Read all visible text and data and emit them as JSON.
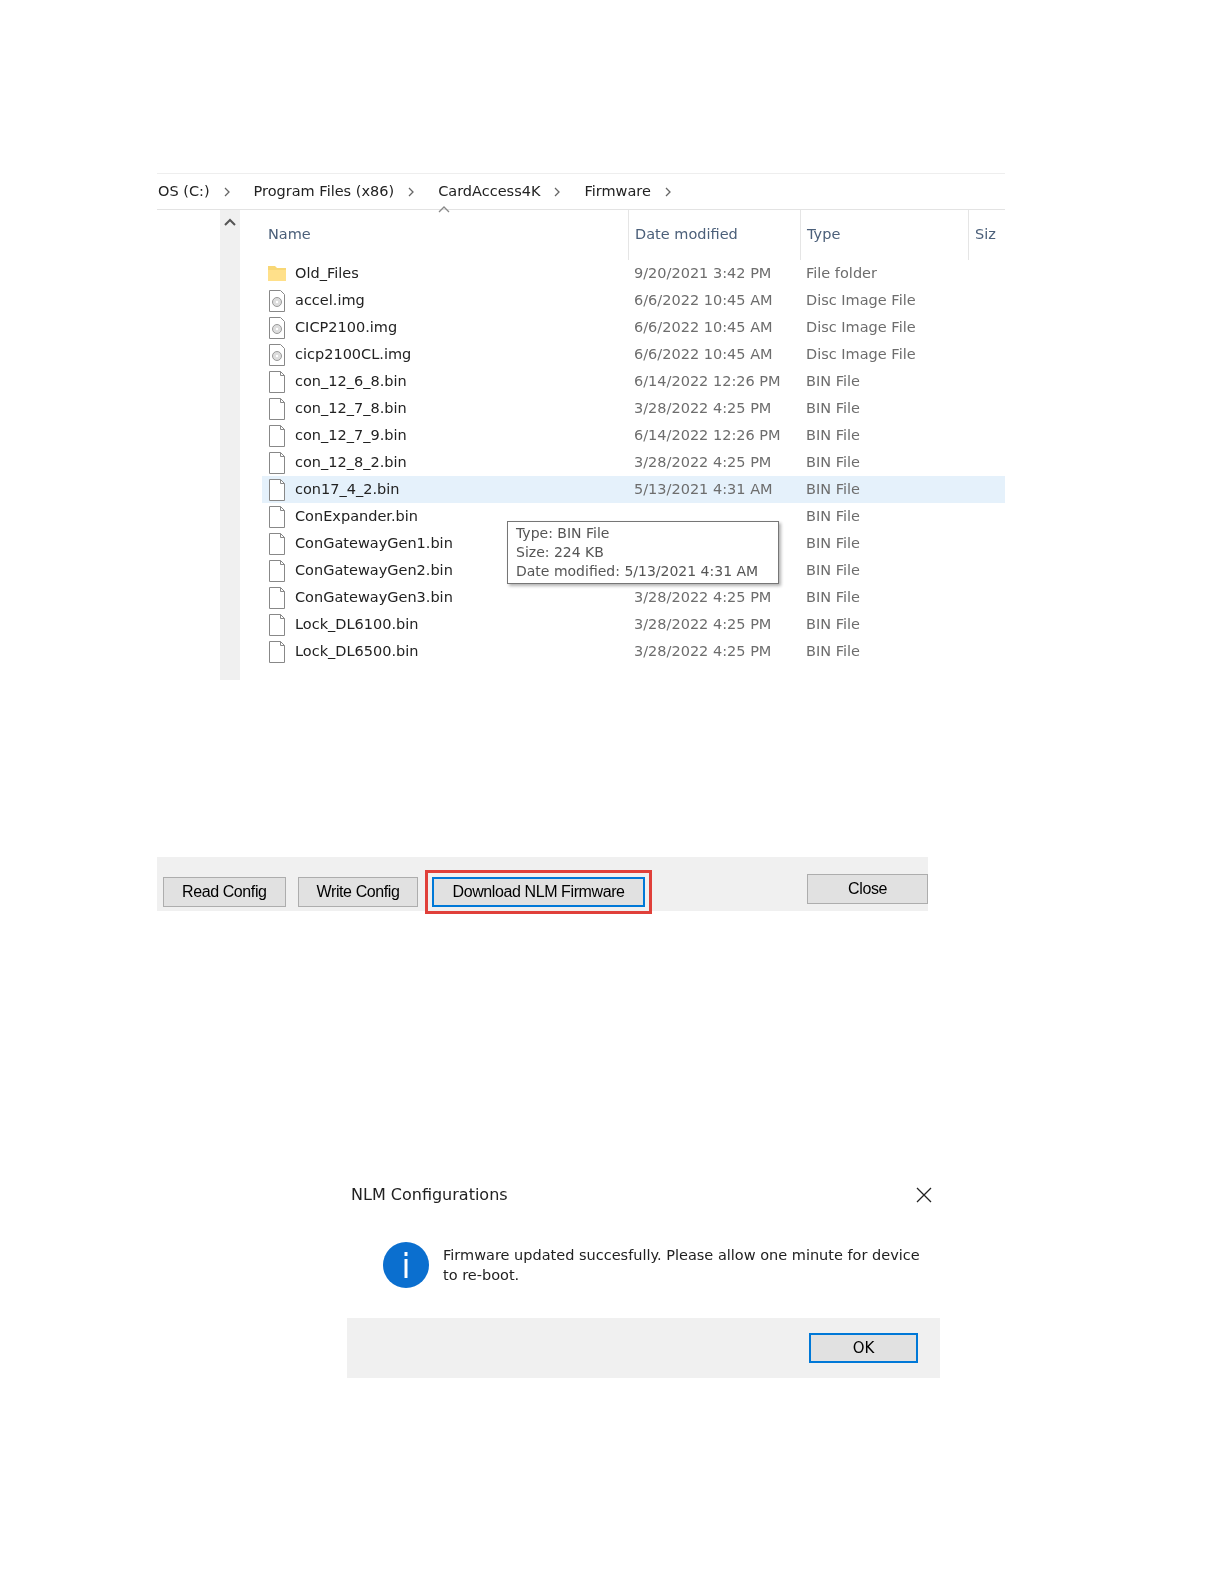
{
  "explorer": {
    "breadcrumb": [
      "OS (C:)",
      "Program Files (x86)",
      "CardAccess4K",
      "Firmware"
    ],
    "columns": [
      "Name",
      "Date modified",
      "Type",
      "Siz"
    ],
    "rows": [
      {
        "kind": "folder",
        "name": "Old_Files",
        "date": "9/20/2021 3:42 PM",
        "type": "File folder",
        "selected": false
      },
      {
        "kind": "disc",
        "name": "accel.img",
        "date": "6/6/2022 10:45 AM",
        "type": "Disc Image File",
        "selected": false
      },
      {
        "kind": "disc",
        "name": "CICP2100.img",
        "date": "6/6/2022 10:45 AM",
        "type": "Disc Image File",
        "selected": false
      },
      {
        "kind": "disc",
        "name": "cicp2100CL.img",
        "date": "6/6/2022 10:45 AM",
        "type": "Disc Image File",
        "selected": false
      },
      {
        "kind": "file",
        "name": "con_12_6_8.bin",
        "date": "6/14/2022 12:26 PM",
        "type": "BIN File",
        "selected": false
      },
      {
        "kind": "file",
        "name": "con_12_7_8.bin",
        "date": "3/28/2022 4:25 PM",
        "type": "BIN File",
        "selected": false
      },
      {
        "kind": "file",
        "name": "con_12_7_9.bin",
        "date": "6/14/2022 12:26 PM",
        "type": "BIN File",
        "selected": false
      },
      {
        "kind": "file",
        "name": "con_12_8_2.bin",
        "date": "3/28/2022 4:25 PM",
        "type": "BIN File",
        "selected": false
      },
      {
        "kind": "file",
        "name": "con17_4_2.bin",
        "date": "5/13/2021 4:31 AM",
        "type": "BIN File",
        "selected": true
      },
      {
        "kind": "file",
        "name": "ConExpander.bin",
        "type": "BIN File",
        "selected": false
      },
      {
        "kind": "file",
        "name": "ConGatewayGen1.bin",
        "type": "BIN File",
        "selected": false
      },
      {
        "kind": "file",
        "name": "ConGatewayGen2.bin",
        "type": "BIN File",
        "selected": false
      },
      {
        "kind": "file",
        "name": "ConGatewayGen3.bin",
        "date": "3/28/2022 4:25 PM",
        "type": "BIN File",
        "selected": false
      },
      {
        "kind": "file",
        "name": "Lock_DL6100.bin",
        "date": "3/28/2022 4:25 PM",
        "type": "BIN File",
        "selected": false
      },
      {
        "kind": "file",
        "name": "Lock_DL6500.bin",
        "date": "3/28/2022 4:25 PM",
        "type": "BIN File",
        "selected": false
      }
    ],
    "tooltip": [
      "Type: BIN File",
      "Size: 224 KB",
      "Date modified: 5/13/2021 4:31 AM"
    ]
  },
  "config_buttons": [
    {
      "label": "Read Config",
      "highlighted": false
    },
    {
      "label": "Write Config",
      "highlighted": false
    },
    {
      "label": "Download NLM Firmware",
      "highlighted": true
    },
    {
      "label": "Close",
      "highlighted": false
    }
  ],
  "dialog": {
    "title": "NLM Configurations",
    "message": "Firmware updated succesfully. Please allow one minute for device to re-boot.",
    "button": "OK"
  }
}
